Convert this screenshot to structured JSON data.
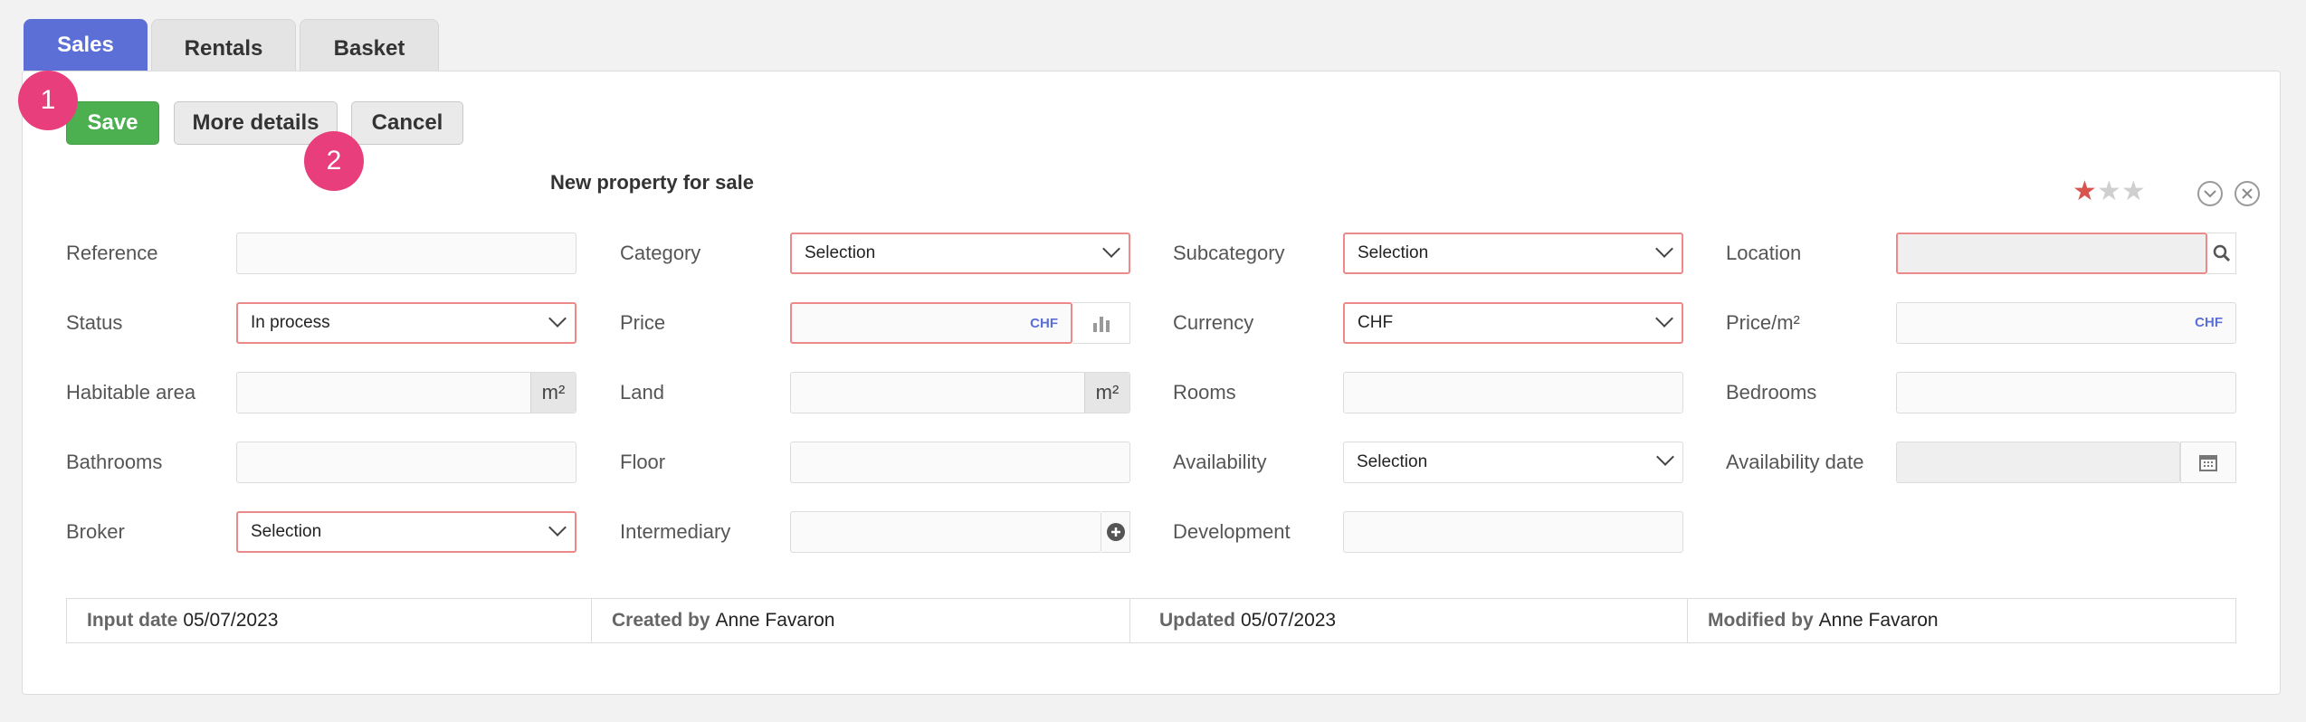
{
  "tabs": [
    {
      "label": "Sales",
      "active": true
    },
    {
      "label": "Rentals",
      "active": false
    },
    {
      "label": "Basket",
      "active": false
    }
  ],
  "toolbar": {
    "save_label": "Save",
    "more_label": "More details",
    "cancel_label": "Cancel"
  },
  "badges": {
    "one": "1",
    "two": "2"
  },
  "title": "New property for sale",
  "rating": {
    "filled": 1,
    "max": 3,
    "filled_color": "#d9534f"
  },
  "icons": {
    "chevron": "chevron-down-circle-icon",
    "close": "close-circle-icon",
    "search": "search-icon",
    "chart": "bar-chart-icon",
    "calendar": "calendar-icon",
    "plus": "plus-circle-icon"
  },
  "form": {
    "reference": {
      "label": "Reference",
      "value": ""
    },
    "category": {
      "label": "Category",
      "value": "Selection"
    },
    "subcategory": {
      "label": "Subcategory",
      "value": "Selection"
    },
    "location": {
      "label": "Location",
      "value": ""
    },
    "status": {
      "label": "Status",
      "value": "In process"
    },
    "price": {
      "label": "Price",
      "value": "",
      "unit": "CHF"
    },
    "currency": {
      "label": "Currency",
      "value": "CHF"
    },
    "price_m2": {
      "label": "Price/m²",
      "value": "",
      "unit": "CHF"
    },
    "habitable": {
      "label": "Habitable area",
      "value": "",
      "unit": "m²"
    },
    "land": {
      "label": "Land",
      "value": "",
      "unit": "m²"
    },
    "rooms": {
      "label": "Rooms",
      "value": ""
    },
    "bedrooms": {
      "label": "Bedrooms",
      "value": ""
    },
    "bathrooms": {
      "label": "Bathrooms",
      "value": ""
    },
    "floor": {
      "label": "Floor",
      "value": ""
    },
    "availability": {
      "label": "Availability",
      "value": "Selection"
    },
    "availability_date": {
      "label": "Availability date",
      "value": ""
    },
    "broker": {
      "label": "Broker",
      "value": "Selection"
    },
    "intermediary": {
      "label": "Intermediary",
      "value": ""
    },
    "development": {
      "label": "Development",
      "value": ""
    }
  },
  "footer": {
    "input_date_label": "Input date",
    "input_date": "05/07/2023",
    "created_by_label": "Created by",
    "created_by": "Anne Favaron",
    "updated_label": "Updated",
    "updated": "05/07/2023",
    "modified_by_label": "Modified by",
    "modified_by": "Anne Favaron"
  }
}
